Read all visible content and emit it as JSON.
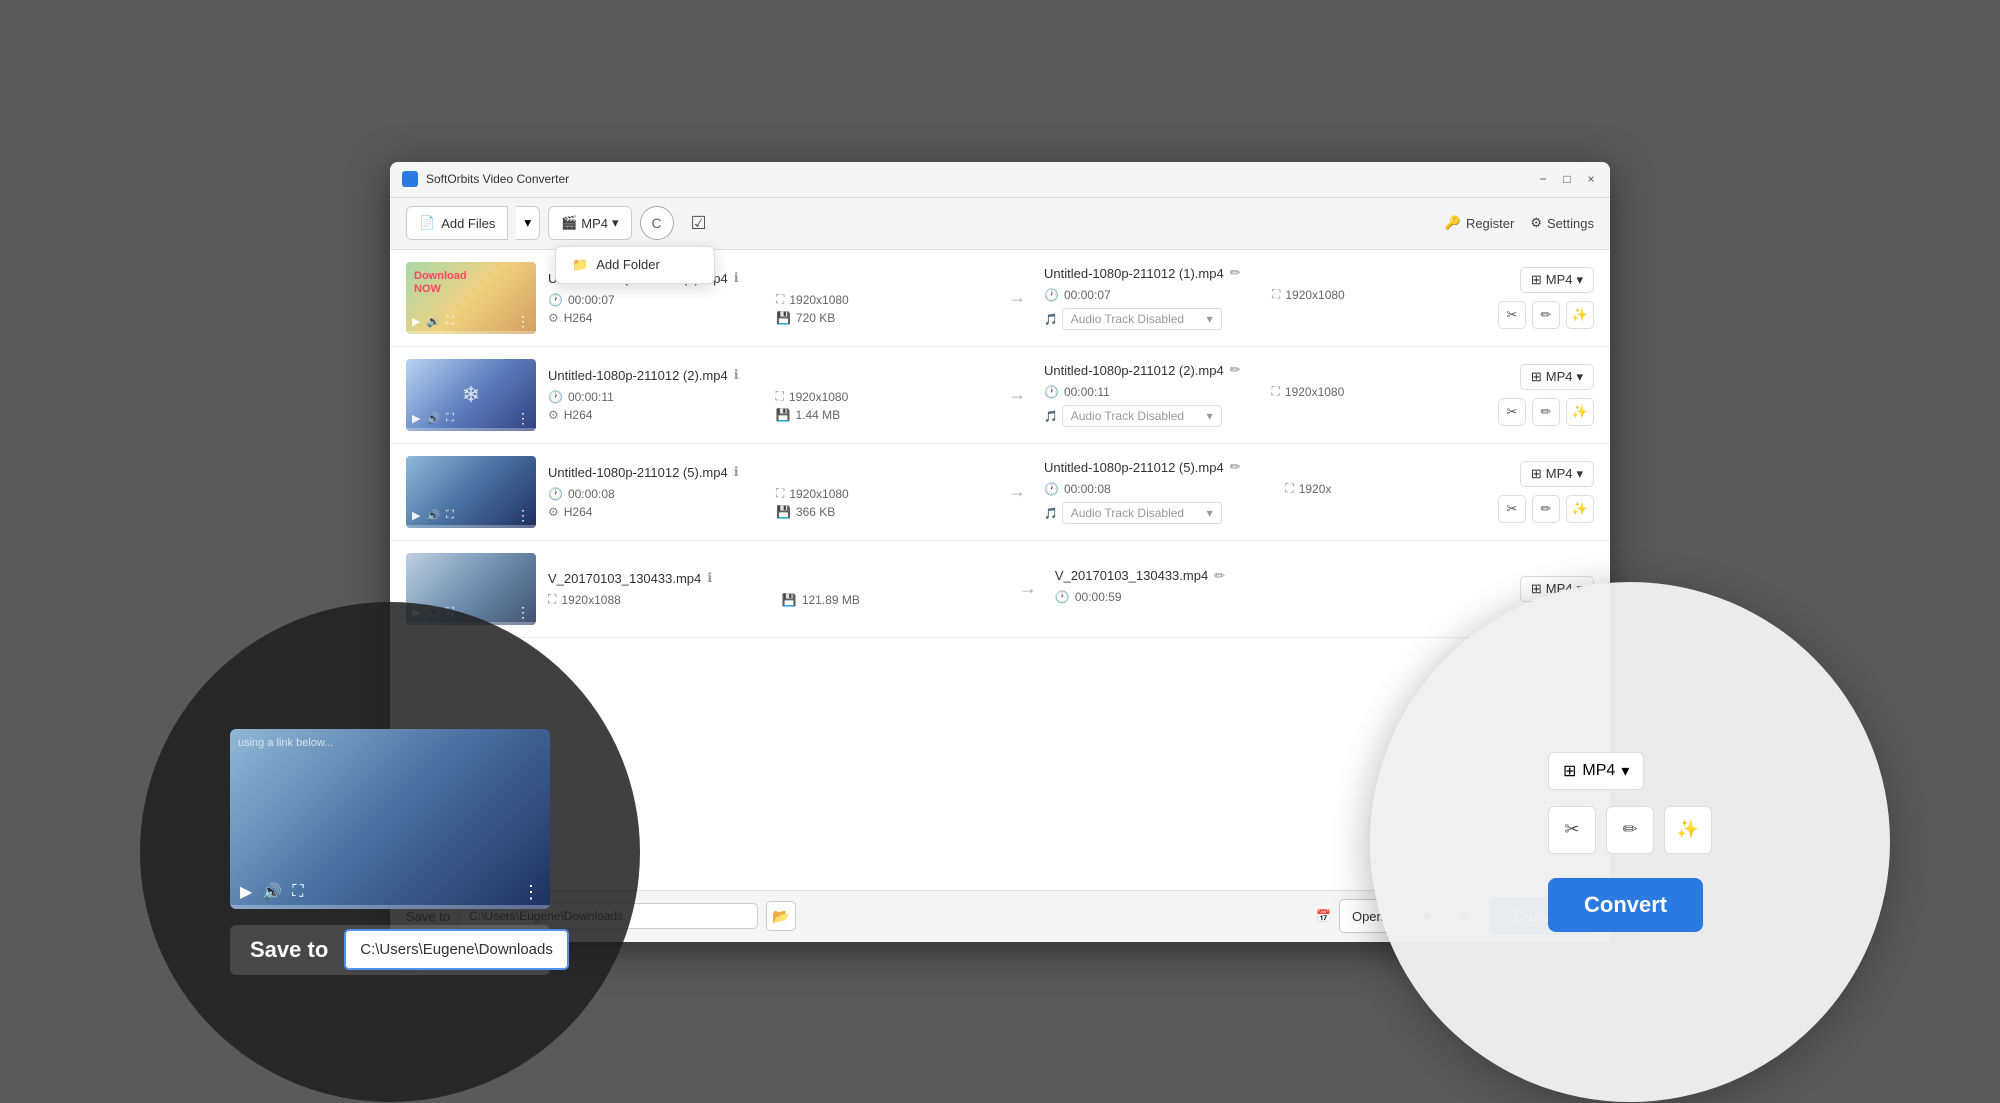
{
  "app": {
    "title": "SoftOrbits Video Converter",
    "window_controls": {
      "minimize": "−",
      "maximize": "□",
      "close": "×"
    }
  },
  "toolbar": {
    "add_files_label": "Add Files",
    "format_label": "MP4",
    "clear_label": "C",
    "register_label": "Register",
    "settings_label": "Settings"
  },
  "dropdown": {
    "items": [
      {
        "label": "Add Folder",
        "icon": "📁"
      }
    ]
  },
  "files": [
    {
      "id": 1,
      "thumb_class": "thumb-img-1",
      "source_name": "Untitled-1080p-211012 (1).mp4",
      "duration": "00:00:07",
      "resolution": "1920x1080",
      "codec": "H264",
      "size": "720 KB",
      "output_name": "Untitled-1080p-211012 (1).mp4",
      "out_duration": "00:00:07",
      "out_resolution": "1920x1080",
      "audio_track": "Audio Track Disabled",
      "format": "MP4"
    },
    {
      "id": 2,
      "thumb_class": "thumb-img-2",
      "source_name": "Untitled-1080p-211012 (2).mp4",
      "duration": "00:00:11",
      "resolution": "1920x1080",
      "codec": "H264",
      "size": "1.44 MB",
      "output_name": "Untitled-1080p-211012 (2).mp4",
      "out_duration": "00:00:11",
      "out_resolution": "1920x1080",
      "audio_track": "Audio Track Disabled",
      "format": "MP4"
    },
    {
      "id": 3,
      "thumb_class": "thumb-img-3",
      "source_name": "Untitled-1080p-211012 (5).mp4",
      "duration": "00:00:08",
      "resolution": "1920x1080",
      "codec": "H264",
      "size": "366 KB",
      "output_name": "Untitled-1080p-211012 (5).mp4",
      "out_duration": "00:00:08",
      "out_resolution": "1920x",
      "audio_track": "Audio Track Disabled",
      "format": "MP4"
    },
    {
      "id": 4,
      "thumb_class": "thumb-img-4",
      "source_name": "V_20170103_130433.mp4",
      "duration": "",
      "resolution": "1920x1088",
      "codec": "",
      "size": "121.89 MB",
      "output_name": "V_20170103_130433.mp4",
      "out_duration": "00:00:59",
      "out_resolution": "",
      "audio_track": "",
      "format": "MP4"
    }
  ],
  "bottom_bar": {
    "save_to_label": "Save to",
    "save_path": "C:\\Users\\Eugene\\Downloads",
    "open_label": "Open...",
    "convert_label": "Convert"
  },
  "zoom_left": {
    "save_label": "Save to",
    "save_path": "C:\\Users\\Eugene\\Downloads"
  },
  "zoom_right": {
    "format_label": "MP4",
    "convert_label": "Convert",
    "action_cut": "✂",
    "action_edit": "✏",
    "action_magic": "✨"
  }
}
